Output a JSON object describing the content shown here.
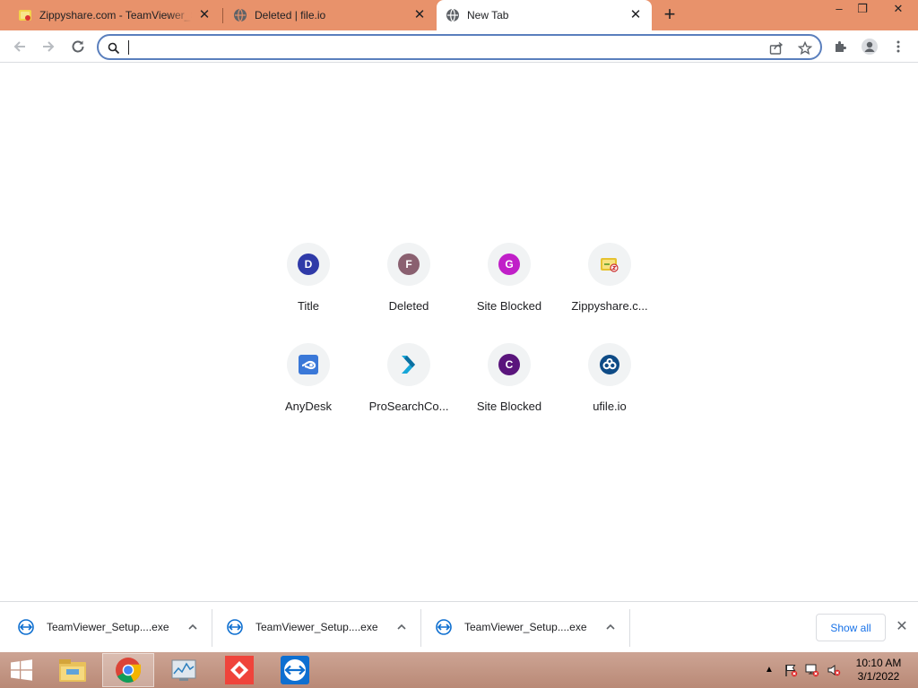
{
  "tabs": [
    {
      "title": "Zippyshare.com - TeamViewer_Setup.exe",
      "favicon": "zippyshare-icon",
      "active": false
    },
    {
      "title": "Deleted | file.io",
      "favicon": "globe-icon",
      "active": false
    },
    {
      "title": "New Tab",
      "favicon": "globe-icon",
      "active": true
    }
  ],
  "omnibox": {
    "value": "",
    "placeholder": ""
  },
  "shortcuts": [
    {
      "label": "Title",
      "letter": "D",
      "color": "#2f3aa8",
      "icon": "letter-d-icon"
    },
    {
      "label": "Deleted",
      "letter": "F",
      "color": "#8a6070",
      "icon": "letter-f-icon"
    },
    {
      "label": "Site Blocked",
      "letter": "G",
      "color": "#c01fc8",
      "icon": "letter-g-icon"
    },
    {
      "label": "Zippyshare.c...",
      "letter": "",
      "color": "#e6c230",
      "icon": "zippyshare-icon"
    },
    {
      "label": "AnyDesk",
      "letter": "",
      "color": "#3a78d8",
      "icon": "anydesk-icon"
    },
    {
      "label": "ProSearchCo...",
      "letter": "",
      "color": "#16a6d8",
      "icon": "prosearch-icon"
    },
    {
      "label": "Site Blocked",
      "letter": "C",
      "color": "#5a157c",
      "icon": "letter-c-icon"
    },
    {
      "label": "ufile.io",
      "letter": "",
      "color": "#0e4b86",
      "icon": "ufile-icon"
    }
  ],
  "downloads": [
    {
      "name": "TeamViewer_Setup....exe",
      "icon": "teamviewer-icon"
    },
    {
      "name": "TeamViewer_Setup....exe",
      "icon": "teamviewer-icon"
    },
    {
      "name": "TeamViewer_Setup....exe",
      "icon": "teamviewer-icon"
    }
  ],
  "shelf": {
    "show_all": "Show all"
  },
  "taskbar": {
    "apps": [
      "file-explorer-icon",
      "chrome-icon",
      "resource-monitor-icon",
      "anydesk-icon",
      "teamviewer-icon"
    ],
    "time": "10:10 AM",
    "date": "3/1/2022"
  },
  "colors": {
    "titlebar": "#e8926b",
    "accent": "#1a73e8",
    "taskbar": "#c29886"
  }
}
